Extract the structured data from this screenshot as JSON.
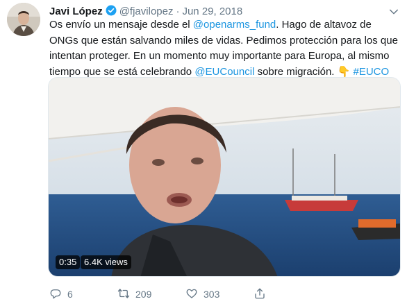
{
  "tweet": {
    "author_name": "Javi López",
    "handle": "@fjavilopez",
    "separator": "·",
    "date": "Jun 29, 2018",
    "text": {
      "part1": "Os envío un mensaje desde el ",
      "mention1": "@openarms_fund",
      "part2": ". Hago de altavoz de ONGs que están salvando miles de vidas. Pedimos protección para los que intentan proteger. En un momento muy importante para Europa, al mismo tiempo que se está celebrando ",
      "mention2": "@EUCouncil",
      "part3": " sobre migración. ",
      "emoji": "👇",
      "part4": " ",
      "hashtag": "#EUCO"
    },
    "video": {
      "duration": "0:35",
      "views": "6.4K views"
    },
    "actions": {
      "replies": "6",
      "retweets": "209",
      "likes": "303"
    }
  },
  "colors": {
    "link": "#1b95e0",
    "verified": "#1da1f2",
    "secondary_text": "#657786"
  },
  "icons": [
    "verified-badge-icon",
    "chevron-down-icon",
    "reply-icon",
    "retweet-icon",
    "like-icon",
    "share-icon"
  ]
}
